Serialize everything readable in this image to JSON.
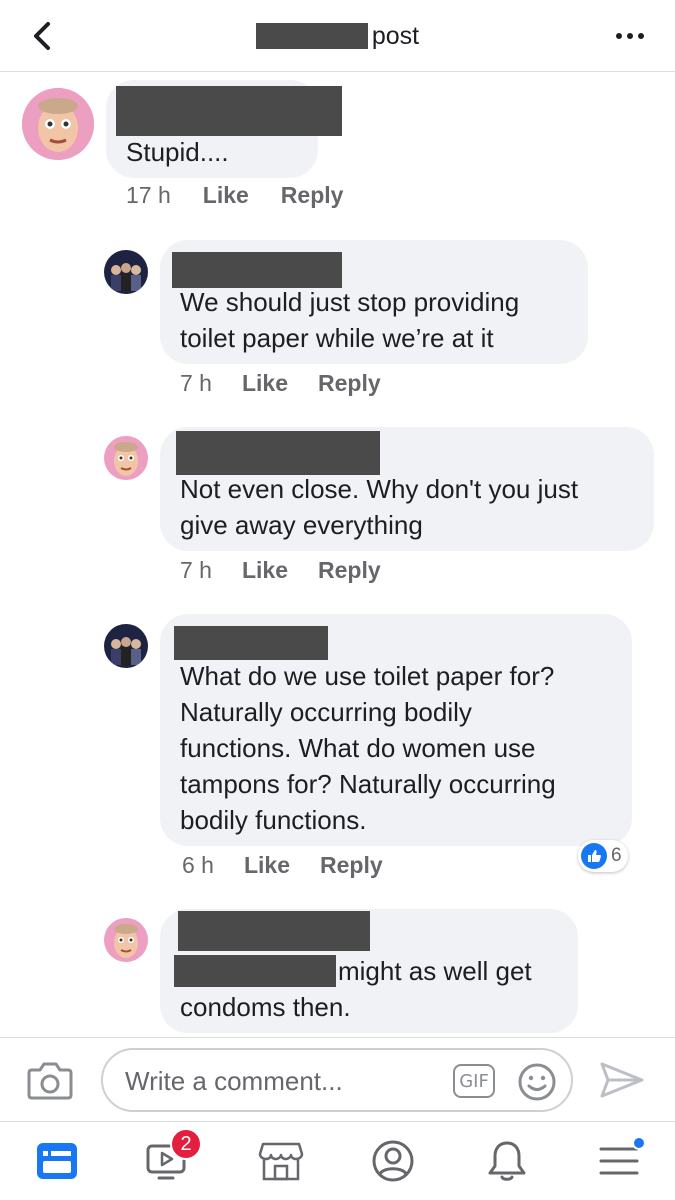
{
  "header": {
    "title": "post",
    "back_icon": "chevron-left-icon",
    "more_icon": "more-dots-icon"
  },
  "comments": [
    {
      "avatar": "rodney-avatar",
      "text": "Stupid....",
      "time": "17 h",
      "like_label": "Like",
      "reply_label": "Reply"
    },
    {
      "avatar": "group-photo-avatar",
      "text": "We should just stop providing\ntoilet paper while we’re at it",
      "time": "7 h",
      "like_label": "Like",
      "reply_label": "Reply"
    },
    {
      "avatar": "rodney-avatar",
      "text": "Not even close. Why don't you just\ngive away everything",
      "time": "7 h",
      "like_label": "Like",
      "reply_label": "Reply"
    },
    {
      "avatar": "group-photo-avatar",
      "text": "What do we use toilet paper for?\nNaturally occurring bodily\nfunctions. What do women use\ntampons for? Naturally occurring\nbodily functions.",
      "time": "6 h",
      "like_label": "Like",
      "reply_label": "Reply",
      "reaction_count": "6"
    },
    {
      "avatar": "rodney-avatar",
      "text_line1": "might as well get",
      "text_line2": "condoms then."
    }
  ],
  "composer": {
    "placeholder": "Write a comment...",
    "gif_label": "GIF"
  },
  "tabbar": {
    "watch_badge": "2"
  },
  "colors": {
    "accent": "#1877f2",
    "bubble": "#f0f2f5",
    "meta_text": "#65676b",
    "badge": "#e41e3f",
    "redaction": "#4a4a4a"
  }
}
